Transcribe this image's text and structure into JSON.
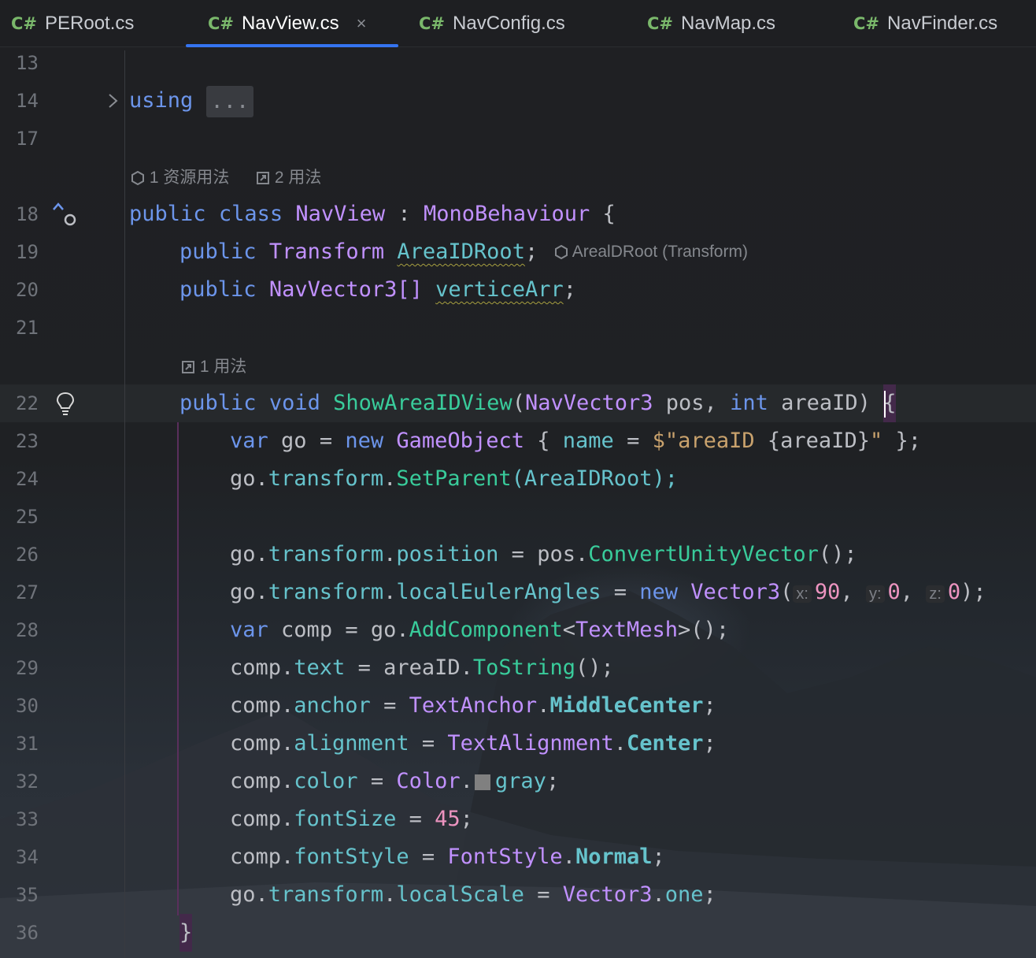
{
  "tabs": [
    {
      "lang": "C#",
      "name": "PERoot.cs",
      "active": false
    },
    {
      "lang": "C#",
      "name": "NavView.cs",
      "active": true,
      "close": "×"
    },
    {
      "lang": "C#",
      "name": "NavConfig.cs",
      "active": false
    },
    {
      "lang": "C#",
      "name": "NavMap.cs",
      "active": false
    },
    {
      "lang": "C#",
      "name": "NavFinder.cs",
      "active": false
    }
  ],
  "line_numbers": [
    "13",
    "14",
    "17",
    "18",
    "19",
    "20",
    "21",
    "22",
    "23",
    "24",
    "25",
    "26",
    "27",
    "28",
    "29",
    "30",
    "31",
    "32",
    "33",
    "34",
    "35",
    "36"
  ],
  "code_lens": {
    "class_usages": {
      "resource": "1 资源用法",
      "usages": "2 用法"
    },
    "method_usages": "1 用法"
  },
  "inline_hint_arearoot": "ArealDRoot (Transform)",
  "code": {
    "using_kw": "using",
    "using_fold": "...",
    "public": "public",
    "class": "class",
    "navview": "NavView",
    "colon": ":",
    "monobehaviour": "MonoBehaviour",
    "open_brace": "{",
    "close_brace": "}",
    "transform_type": "Transform",
    "arearoot": "AreaIDRoot",
    "semicolon": ";",
    "navvector3arr": "NavVector3[]",
    "verticearr": "verticeArr",
    "void": "void",
    "showareaidview": "ShowAreaIDView",
    "paren_open": "(",
    "navvector3": "NavVector3",
    "pos_param": "pos,",
    "int": "int",
    "areaid_param": "areaID)",
    "var": "var",
    "go": "go",
    "eq": "=",
    "new": "new",
    "gameobject": "GameObject",
    "name_fld": "name",
    "interp_start": "$\"areaID ",
    "interp_expr": "{areaID}",
    "interp_end": "\"",
    "end_brace_semicolon": "};",
    "go_dot": "go.",
    "transform": "transform",
    "dot": ".",
    "setparent": "SetParent",
    "arearoot_arg": "(AreaIDRoot);",
    "position": "position",
    "pos_dot": "pos.",
    "convert": "ConvertUnityVector",
    "call_end": "();",
    "localeuler": "localEulerAngles",
    "vector3": "Vector3",
    "hint_x": "x:",
    "val_x": "90",
    "hint_y": "y:",
    "val_y": "0",
    "hint_z": "z:",
    "val_z": "0",
    "comma": ",",
    "close_paren_semi": ");",
    "comp": "comp",
    "addcomponent": "AddComponent",
    "lt": "<",
    "textmesh": "TextMesh",
    "gt_call": ">();",
    "comp_dot": "comp.",
    "text": "text",
    "areaid_dot": "areaID.",
    "tostring": "ToString",
    "anchor": "anchor",
    "textanchor": "TextAnchor",
    "middlecenter": "MiddleCenter",
    "alignment": "alignment",
    "textalignment": "TextAlignment",
    "center": "Center",
    "color": "color",
    "color_type": "Color",
    "gray": "gray",
    "fontsize": "fontSize",
    "val_45": "45",
    "fontstyle": "fontStyle",
    "fontstyle_type": "FontStyle",
    "normal": "Normal",
    "localscale": "localScale",
    "one": "one"
  },
  "colors": {
    "accent": "#3574f0",
    "keyword": "#6c95eb",
    "class": "#c191ff",
    "field": "#66c3cc",
    "method": "#39cc9b",
    "number": "#ed94c0",
    "string": "#c9a26d"
  },
  "icons": [
    "fold-chevron-icon",
    "unity-icon",
    "usages-icon",
    "implemented-up-arrow-icon",
    "bulb-icon",
    "color-swatch-icon"
  ]
}
